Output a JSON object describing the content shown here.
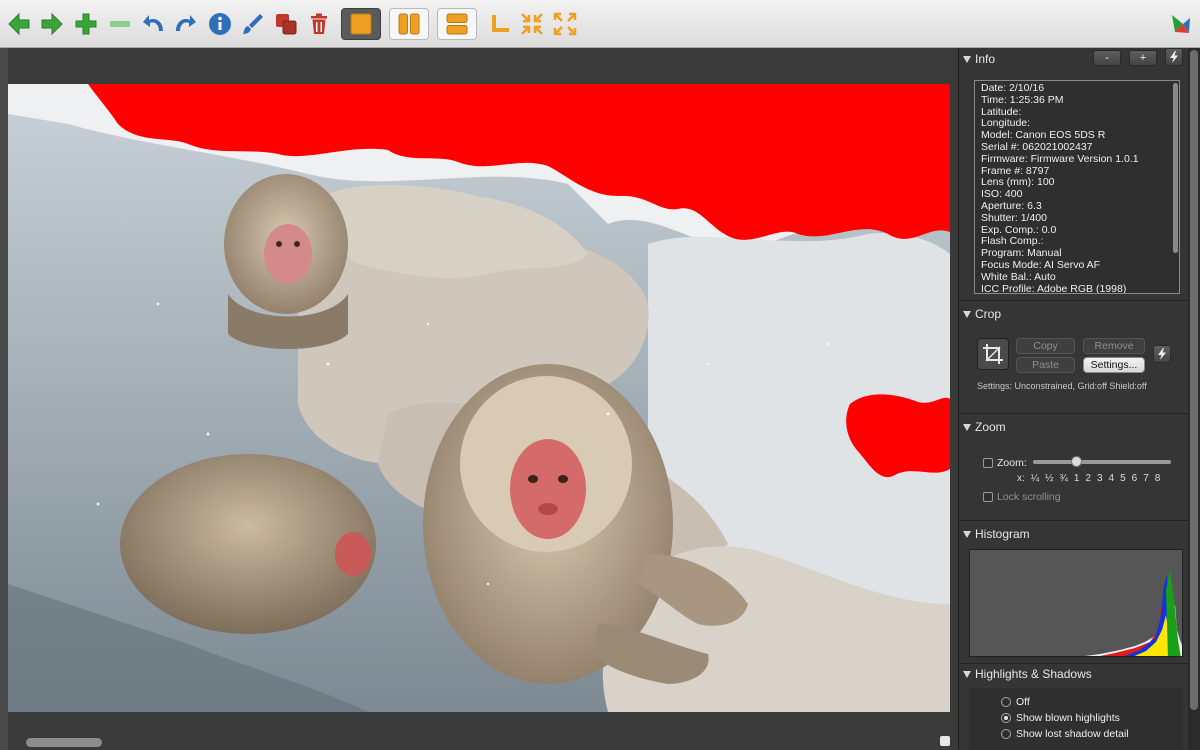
{
  "toolbar": {
    "buttons": [
      {
        "name": "back-arrow-icon",
        "color": "#3aa63a"
      },
      {
        "name": "forward-arrow-icon",
        "color": "#3aa63a"
      },
      {
        "name": "plus-icon",
        "color": "#3aa63a"
      },
      {
        "name": "minus-icon",
        "color": "#8ccf8c"
      },
      {
        "name": "rotate-left-icon",
        "color": "#2d6fb8"
      },
      {
        "name": "rotate-right-icon",
        "color": "#2d6fb8"
      },
      {
        "name": "info-icon",
        "color": "#2d6fb8"
      },
      {
        "name": "brush-icon",
        "color": "#2d6fb8"
      },
      {
        "name": "copy-layers-icon",
        "color": "#c0392b"
      },
      {
        "name": "trash-icon",
        "color": "#c0392b"
      },
      {
        "name": "single-view-icon",
        "color": "#f0a020"
      },
      {
        "name": "split-vertical-icon",
        "color": "#f0a020"
      },
      {
        "name": "split-horizontal-icon",
        "color": "#f0a020"
      },
      {
        "name": "corner-icon",
        "color": "#f0a020"
      },
      {
        "name": "shrink-icon",
        "color": "#f0a020"
      },
      {
        "name": "expand-icon",
        "color": "#f0a020"
      }
    ],
    "app_icon": "app-logo-icon"
  },
  "image": {
    "highlight_overlay_color": "#ff0000"
  },
  "info": {
    "title": "Info",
    "minus_label": "-",
    "plus_label": "+",
    "lines": [
      "Date: 2/10/16",
      "Time: 1:25:36 PM",
      "Latitude:",
      "Longitude:",
      "Model: Canon EOS 5DS R",
      "Serial #: 062021002437",
      "Firmware: Firmware Version 1.0.1",
      "Frame #: 8797",
      "Lens (mm): 100",
      "ISO: 400",
      "Aperture: 6.3",
      "Shutter: 1/400",
      "Exp. Comp.: 0.0",
      "Flash Comp.:",
      "Program: Manual",
      "Focus Mode: AI Servo AF",
      "White Bal.: Auto",
      "ICC Profile: Adobe RGB (1998)"
    ]
  },
  "crop": {
    "title": "Crop",
    "copy_label": "Copy",
    "remove_label": "Remove",
    "paste_label": "Paste",
    "settings_label": "Settings...",
    "settings_text": "Settings:  Unconstrained, Grid:off Shield:off"
  },
  "zoom": {
    "title": "Zoom",
    "zoom_label": "Zoom:",
    "x_label": "x:",
    "ticks": [
      "¼",
      "½",
      "¾",
      "1",
      "2",
      "3",
      "4",
      "5",
      "6",
      "7",
      "8"
    ],
    "lock_label": "Lock scrolling",
    "zoom_checked": false,
    "lock_checked": false
  },
  "histogram": {
    "title": "Histogram"
  },
  "highlights": {
    "title": "Highlights & Shadows",
    "options": [
      {
        "label": "Off",
        "selected": false
      },
      {
        "label": "Show blown highlights",
        "selected": true
      },
      {
        "label": "Show lost shadow detail",
        "selected": false
      }
    ]
  }
}
